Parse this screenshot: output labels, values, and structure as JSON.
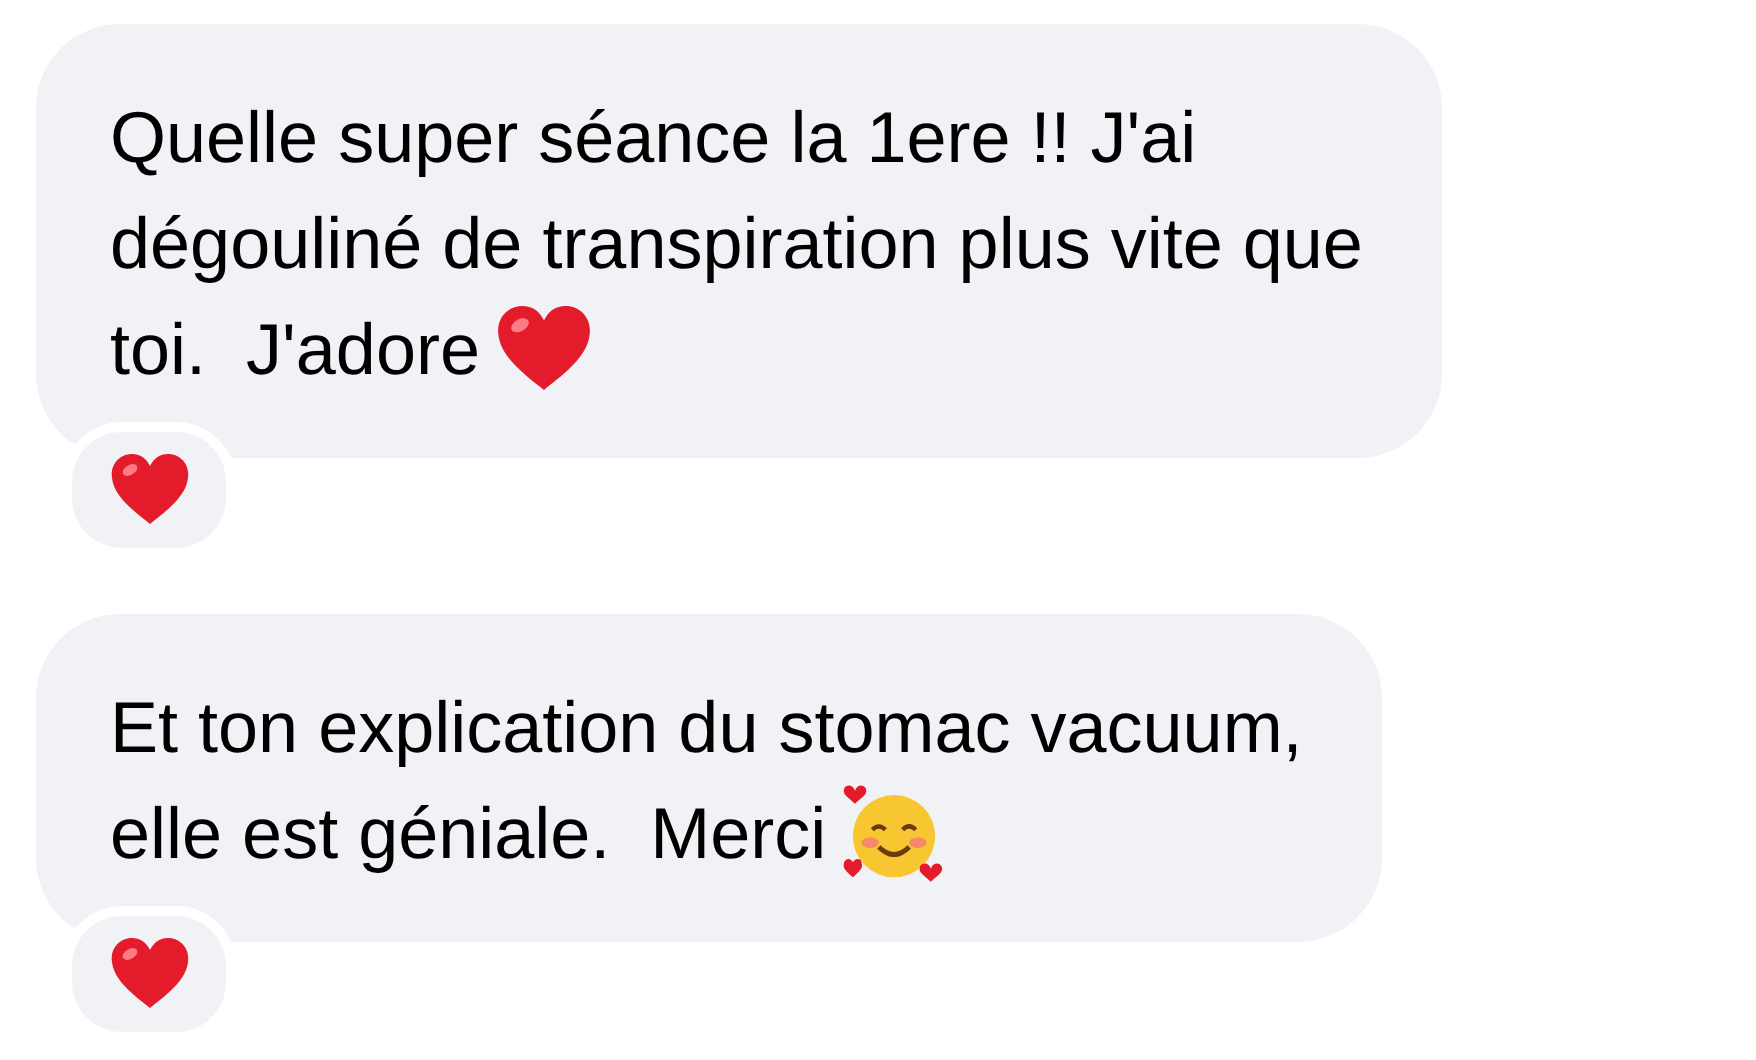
{
  "messages": [
    {
      "lines": [
        "Quelle super séance la 1ere !! J'ai",
        "dégouliné de transpiration plus vite que",
        "toi.  J'adore"
      ],
      "kind": "heart",
      "reacted": true
    },
    {
      "lines": [
        "Et ton explication du stomac vacuum,",
        "elle est géniale.  Merci"
      ],
      "kind": "smiling-hearts",
      "reacted": true
    }
  ]
}
